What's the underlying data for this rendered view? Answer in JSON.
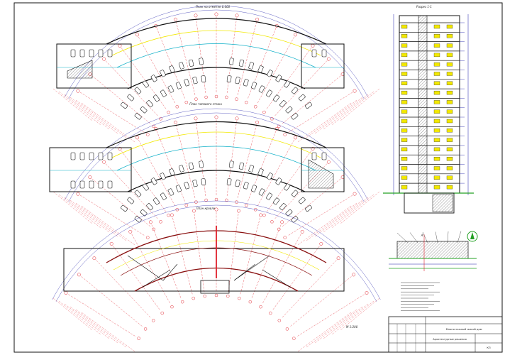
{
  "drawing": {
    "plans": [
      {
        "id": "plan-1",
        "title": "План на отметке 0.000"
      },
      {
        "id": "plan-2",
        "title": "План типового этажа"
      },
      {
        "id": "plan-3",
        "title": "План кровли"
      }
    ],
    "section": {
      "title": "Разрез 1-1"
    },
    "detail": {
      "mark": "А"
    },
    "scale_note": "М 1:200",
    "title_block": {
      "project": "Многоэтажный жилой дом",
      "sheet_name": "Архитектурные решения",
      "sheet_code": "КП"
    },
    "palette": {
      "axis": "#e0202a",
      "walls": "#101010",
      "dims": "#1a1aa8",
      "cyan": "#10b0c8",
      "yellow": "#f2e800",
      "green": "#22a022"
    }
  }
}
